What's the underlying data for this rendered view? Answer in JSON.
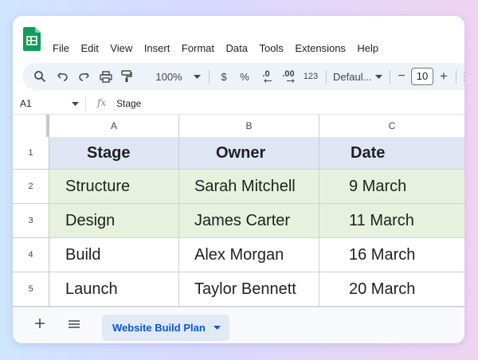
{
  "menu": [
    "File",
    "Edit",
    "View",
    "Insert",
    "Format",
    "Data",
    "Tools",
    "Extensions",
    "Help"
  ],
  "toolbar": {
    "zoom": "100%",
    "currency": "$",
    "percent": "%",
    "dec_decrease": ".0",
    "dec_increase": ".00",
    "number_format": "123",
    "font": "Defaul...",
    "font_size": "10",
    "minus": "−",
    "plus": "+"
  },
  "formula_bar": {
    "name_box": "A1",
    "fx": "fx",
    "content": "Stage"
  },
  "columns": [
    "A",
    "B",
    "C"
  ],
  "rows": [
    {
      "num": "1",
      "cells": [
        "Stage",
        "Owner",
        "Date"
      ]
    },
    {
      "num": "2",
      "cells": [
        "Structure",
        "Sarah Mitchell",
        "9 March"
      ]
    },
    {
      "num": "3",
      "cells": [
        "Design",
        "James Carter",
        "11 March"
      ]
    },
    {
      "num": "4",
      "cells": [
        "Build",
        "Alex Morgan",
        "16 March"
      ]
    },
    {
      "num": "5",
      "cells": [
        "Launch",
        "Taylor Bennett",
        "20 March"
      ]
    }
  ],
  "sheet_tab": {
    "label": "Website Build Plan"
  },
  "colors": {
    "header_fill": "#dfe5f3",
    "highlight_fill": "#e6f2dd",
    "accent": "#0b57d0",
    "sheets_green": "#0f9d58"
  }
}
